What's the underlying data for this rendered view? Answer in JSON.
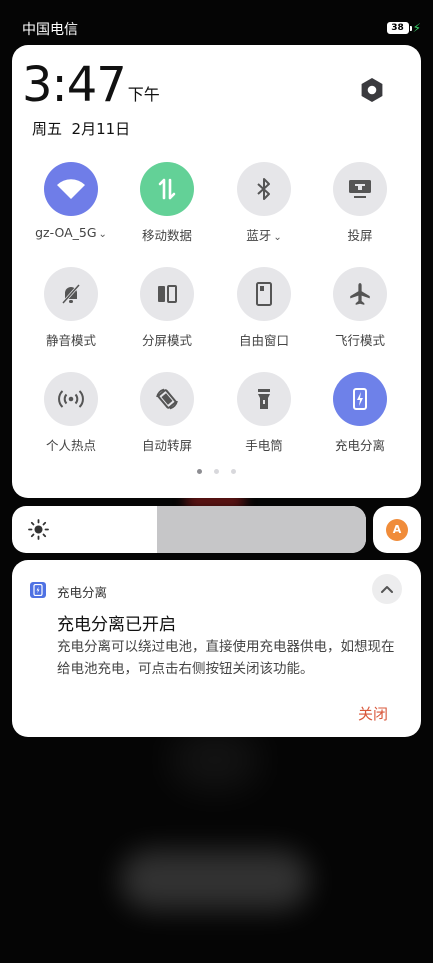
{
  "status_bar": {
    "carrier": "中国电信",
    "battery_level": "38",
    "charging": true
  },
  "panel": {
    "time": "3:47",
    "period": "下午",
    "date": "周五  2月11日",
    "settings_icon": "gear-icon",
    "tiles": [
      {
        "label": "gz-OA_5G",
        "icon": "wifi-icon",
        "active": true,
        "color": "#6f7de8",
        "has_chevron": true
      },
      {
        "label": "移动数据",
        "icon": "mobile-data-icon",
        "active": true,
        "color": "#63d197",
        "has_chevron": false
      },
      {
        "label": "蓝牙",
        "icon": "bluetooth-icon",
        "active": false,
        "has_chevron": true
      },
      {
        "label": "投屏",
        "icon": "cast-screen-icon",
        "active": false,
        "has_chevron": false
      },
      {
        "label": "静音模式",
        "icon": "mute-bell-icon",
        "active": false
      },
      {
        "label": "分屏模式",
        "icon": "split-screen-icon",
        "active": false
      },
      {
        "label": "自由窗口",
        "icon": "floating-window-icon",
        "active": false
      },
      {
        "label": "飞行模式",
        "icon": "airplane-icon",
        "active": false
      },
      {
        "label": "个人热点",
        "icon": "hotspot-icon",
        "active": false
      },
      {
        "label": "自动转屏",
        "icon": "auto-rotate-icon",
        "active": false
      },
      {
        "label": "手电筒",
        "icon": "flashlight-icon",
        "active": false
      },
      {
        "label": "充电分离",
        "icon": "charge-separation-icon",
        "active": true,
        "color": "#6e81e9"
      }
    ],
    "page_indicator": {
      "pages": 3,
      "current": 1
    }
  },
  "brightness": {
    "level": 0.41,
    "auto_label": "A"
  },
  "notification": {
    "app_name": "充电分离",
    "title": "充电分离已开启",
    "body": "充电分离可以绕过电池，直接使用充电器供电，如想现在给电池充电，可点击右侧按钮关闭该功能。",
    "action": "关闭"
  }
}
